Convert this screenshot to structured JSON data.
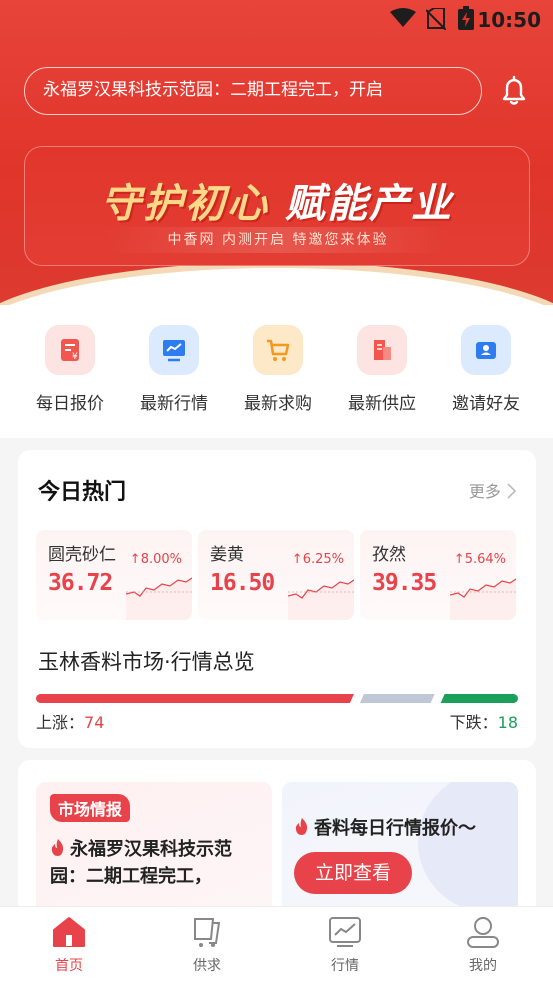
{
  "status": {
    "time": "10:50"
  },
  "header": {
    "ticker_text": "永福罗汉果科技示范园：二期工程完工，开启",
    "banner_title_1": "守护初心",
    "banner_title_2": "赋能产业",
    "banner_subtitle": "中香网  内测开启  特邀您来体验"
  },
  "quick_actions": [
    {
      "label": "每日报价",
      "icon": "price-sheet-icon"
    },
    {
      "label": "最新行情",
      "icon": "market-chart-icon"
    },
    {
      "label": "最新求购",
      "icon": "shopping-cart-icon"
    },
    {
      "label": "最新供应",
      "icon": "supply-building-icon"
    },
    {
      "label": "邀请好友",
      "icon": "invite-friend-icon"
    }
  ],
  "hot": {
    "title": "今日热门",
    "more": "更多",
    "items": [
      {
        "name": "圆壳砂仁",
        "price": "36.72",
        "change": "↑8.00%"
      },
      {
        "name": "姜黄",
        "price": "16.50",
        "change": "↑6.25%"
      },
      {
        "name": "孜然",
        "price": "39.35",
        "change": "↑5.64%"
      }
    ],
    "market_title": "玉林香料市场·行情总览",
    "up_label": "上涨：",
    "up_count": "74",
    "down_label": "下跌：",
    "down_count": "18",
    "colors": {
      "up": "#e8434a",
      "flat": "#c0c8d8",
      "down": "#1aa05b"
    }
  },
  "info": {
    "intel_tag": "市场情报",
    "intel_text": "永福罗汉果科技示范园：二期工程完工，",
    "daily_text": "香料每日行情报价～",
    "daily_button": "立即查看"
  },
  "tabs": [
    {
      "label": "首页",
      "icon": "home-icon",
      "active": true
    },
    {
      "label": "供求",
      "icon": "supply-demand-icon",
      "active": false
    },
    {
      "label": "行情",
      "icon": "market-icon",
      "active": false
    },
    {
      "label": "我的",
      "icon": "profile-icon",
      "active": false
    }
  ]
}
